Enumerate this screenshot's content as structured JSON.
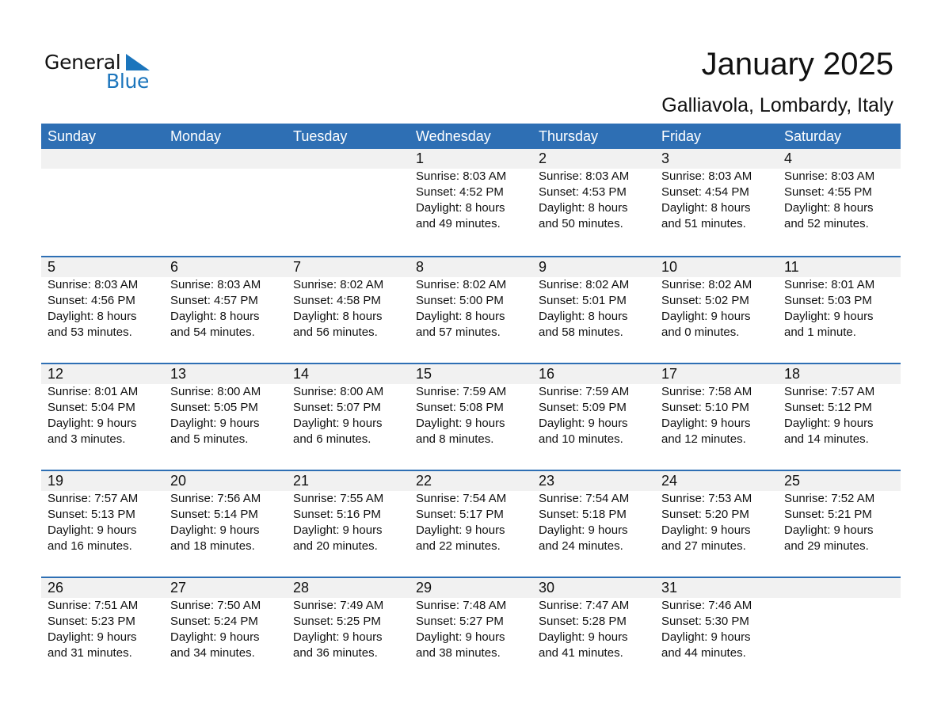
{
  "logo": {
    "word1": "General",
    "word2": "Blue",
    "icon": "triangle-flag-icon",
    "brand_color": "#1b75bc"
  },
  "title": "January 2025",
  "subtitle": "Galliavola, Lombardy, Italy",
  "colors": {
    "header_bg": "#2e6fb4",
    "header_text": "#ffffff",
    "day_band_bg": "#f1f1f1"
  },
  "weekdays": [
    "Sunday",
    "Monday",
    "Tuesday",
    "Wednesday",
    "Thursday",
    "Friday",
    "Saturday"
  ],
  "weeks": [
    [
      null,
      null,
      null,
      {
        "day": "1",
        "sunrise": "Sunrise: 8:03 AM",
        "sunset": "Sunset: 4:52 PM",
        "daylight1": "Daylight: 8 hours",
        "daylight2": "and 49 minutes."
      },
      {
        "day": "2",
        "sunrise": "Sunrise: 8:03 AM",
        "sunset": "Sunset: 4:53 PM",
        "daylight1": "Daylight: 8 hours",
        "daylight2": "and 50 minutes."
      },
      {
        "day": "3",
        "sunrise": "Sunrise: 8:03 AM",
        "sunset": "Sunset: 4:54 PM",
        "daylight1": "Daylight: 8 hours",
        "daylight2": "and 51 minutes."
      },
      {
        "day": "4",
        "sunrise": "Sunrise: 8:03 AM",
        "sunset": "Sunset: 4:55 PM",
        "daylight1": "Daylight: 8 hours",
        "daylight2": "and 52 minutes."
      }
    ],
    [
      {
        "day": "5",
        "sunrise": "Sunrise: 8:03 AM",
        "sunset": "Sunset: 4:56 PM",
        "daylight1": "Daylight: 8 hours",
        "daylight2": "and 53 minutes."
      },
      {
        "day": "6",
        "sunrise": "Sunrise: 8:03 AM",
        "sunset": "Sunset: 4:57 PM",
        "daylight1": "Daylight: 8 hours",
        "daylight2": "and 54 minutes."
      },
      {
        "day": "7",
        "sunrise": "Sunrise: 8:02 AM",
        "sunset": "Sunset: 4:58 PM",
        "daylight1": "Daylight: 8 hours",
        "daylight2": "and 56 minutes."
      },
      {
        "day": "8",
        "sunrise": "Sunrise: 8:02 AM",
        "sunset": "Sunset: 5:00 PM",
        "daylight1": "Daylight: 8 hours",
        "daylight2": "and 57 minutes."
      },
      {
        "day": "9",
        "sunrise": "Sunrise: 8:02 AM",
        "sunset": "Sunset: 5:01 PM",
        "daylight1": "Daylight: 8 hours",
        "daylight2": "and 58 minutes."
      },
      {
        "day": "10",
        "sunrise": "Sunrise: 8:02 AM",
        "sunset": "Sunset: 5:02 PM",
        "daylight1": "Daylight: 9 hours",
        "daylight2": "and 0 minutes."
      },
      {
        "day": "11",
        "sunrise": "Sunrise: 8:01 AM",
        "sunset": "Sunset: 5:03 PM",
        "daylight1": "Daylight: 9 hours",
        "daylight2": "and 1 minute."
      }
    ],
    [
      {
        "day": "12",
        "sunrise": "Sunrise: 8:01 AM",
        "sunset": "Sunset: 5:04 PM",
        "daylight1": "Daylight: 9 hours",
        "daylight2": "and 3 minutes."
      },
      {
        "day": "13",
        "sunrise": "Sunrise: 8:00 AM",
        "sunset": "Sunset: 5:05 PM",
        "daylight1": "Daylight: 9 hours",
        "daylight2": "and 5 minutes."
      },
      {
        "day": "14",
        "sunrise": "Sunrise: 8:00 AM",
        "sunset": "Sunset: 5:07 PM",
        "daylight1": "Daylight: 9 hours",
        "daylight2": "and 6 minutes."
      },
      {
        "day": "15",
        "sunrise": "Sunrise: 7:59 AM",
        "sunset": "Sunset: 5:08 PM",
        "daylight1": "Daylight: 9 hours",
        "daylight2": "and 8 minutes."
      },
      {
        "day": "16",
        "sunrise": "Sunrise: 7:59 AM",
        "sunset": "Sunset: 5:09 PM",
        "daylight1": "Daylight: 9 hours",
        "daylight2": "and 10 minutes."
      },
      {
        "day": "17",
        "sunrise": "Sunrise: 7:58 AM",
        "sunset": "Sunset: 5:10 PM",
        "daylight1": "Daylight: 9 hours",
        "daylight2": "and 12 minutes."
      },
      {
        "day": "18",
        "sunrise": "Sunrise: 7:57 AM",
        "sunset": "Sunset: 5:12 PM",
        "daylight1": "Daylight: 9 hours",
        "daylight2": "and 14 minutes."
      }
    ],
    [
      {
        "day": "19",
        "sunrise": "Sunrise: 7:57 AM",
        "sunset": "Sunset: 5:13 PM",
        "daylight1": "Daylight: 9 hours",
        "daylight2": "and 16 minutes."
      },
      {
        "day": "20",
        "sunrise": "Sunrise: 7:56 AM",
        "sunset": "Sunset: 5:14 PM",
        "daylight1": "Daylight: 9 hours",
        "daylight2": "and 18 minutes."
      },
      {
        "day": "21",
        "sunrise": "Sunrise: 7:55 AM",
        "sunset": "Sunset: 5:16 PM",
        "daylight1": "Daylight: 9 hours",
        "daylight2": "and 20 minutes."
      },
      {
        "day": "22",
        "sunrise": "Sunrise: 7:54 AM",
        "sunset": "Sunset: 5:17 PM",
        "daylight1": "Daylight: 9 hours",
        "daylight2": "and 22 minutes."
      },
      {
        "day": "23",
        "sunrise": "Sunrise: 7:54 AM",
        "sunset": "Sunset: 5:18 PM",
        "daylight1": "Daylight: 9 hours",
        "daylight2": "and 24 minutes."
      },
      {
        "day": "24",
        "sunrise": "Sunrise: 7:53 AM",
        "sunset": "Sunset: 5:20 PM",
        "daylight1": "Daylight: 9 hours",
        "daylight2": "and 27 minutes."
      },
      {
        "day": "25",
        "sunrise": "Sunrise: 7:52 AM",
        "sunset": "Sunset: 5:21 PM",
        "daylight1": "Daylight: 9 hours",
        "daylight2": "and 29 minutes."
      }
    ],
    [
      {
        "day": "26",
        "sunrise": "Sunrise: 7:51 AM",
        "sunset": "Sunset: 5:23 PM",
        "daylight1": "Daylight: 9 hours",
        "daylight2": "and 31 minutes."
      },
      {
        "day": "27",
        "sunrise": "Sunrise: 7:50 AM",
        "sunset": "Sunset: 5:24 PM",
        "daylight1": "Daylight: 9 hours",
        "daylight2": "and 34 minutes."
      },
      {
        "day": "28",
        "sunrise": "Sunrise: 7:49 AM",
        "sunset": "Sunset: 5:25 PM",
        "daylight1": "Daylight: 9 hours",
        "daylight2": "and 36 minutes."
      },
      {
        "day": "29",
        "sunrise": "Sunrise: 7:48 AM",
        "sunset": "Sunset: 5:27 PM",
        "daylight1": "Daylight: 9 hours",
        "daylight2": "and 38 minutes."
      },
      {
        "day": "30",
        "sunrise": "Sunrise: 7:47 AM",
        "sunset": "Sunset: 5:28 PM",
        "daylight1": "Daylight: 9 hours",
        "daylight2": "and 41 minutes."
      },
      {
        "day": "31",
        "sunrise": "Sunrise: 7:46 AM",
        "sunset": "Sunset: 5:30 PM",
        "daylight1": "Daylight: 9 hours",
        "daylight2": "and 44 minutes."
      },
      null
    ]
  ]
}
